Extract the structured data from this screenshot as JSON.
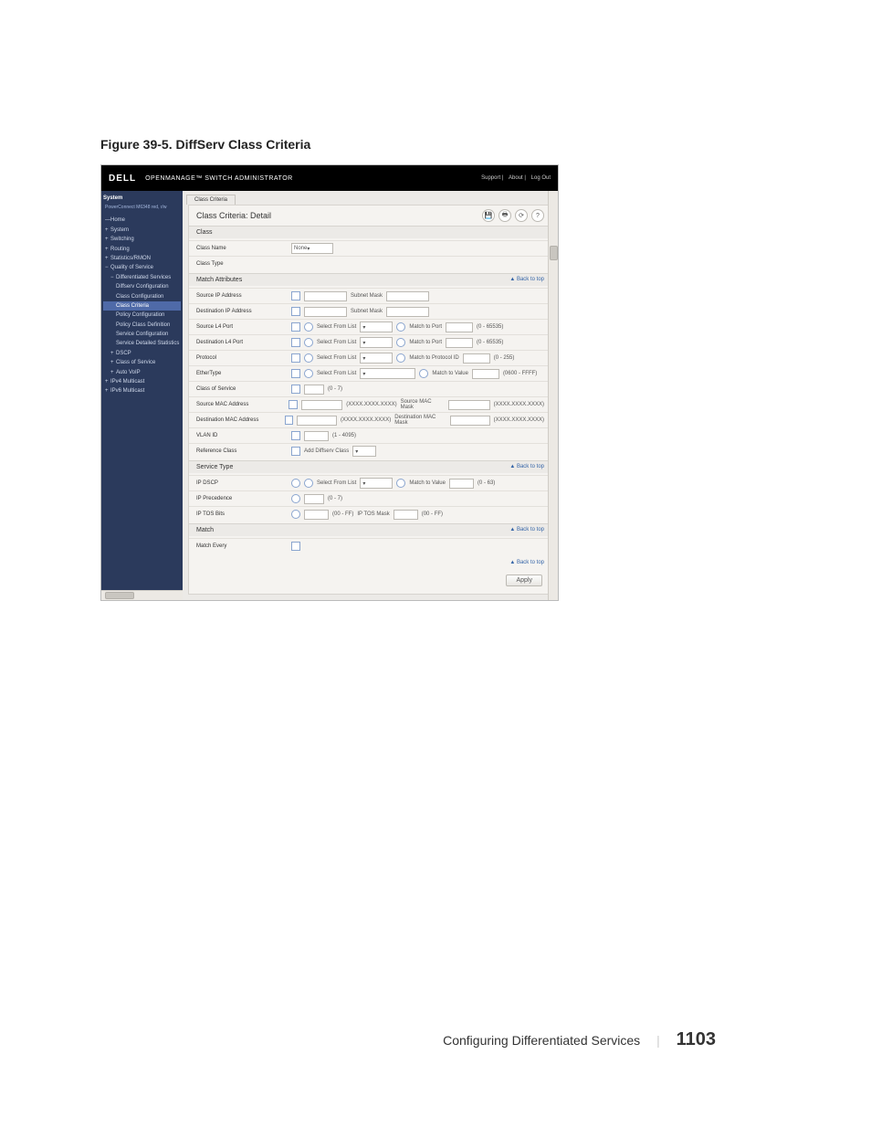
{
  "figure_caption": "Figure 39-5.    DiffServ Class Criteria",
  "topbar": {
    "brand": "DELL",
    "subtitle": "OPENMANAGE™ SWITCH ADMINISTRATOR",
    "links": [
      "Support",
      "About",
      "Log Out"
    ]
  },
  "sidebar": {
    "header": "System",
    "subheader": "PowerConnect M6348\nred, r/w",
    "items": [
      "Home",
      "System",
      "Switching",
      "Routing",
      "Statistics/RMON",
      "Quality of Service"
    ],
    "qos_children": [
      "Differentiated Services",
      "Diffserv Configuration",
      "Class Configuration",
      "Class Criteria",
      "Policy Configuration",
      "Policy Class Definition",
      "Service Configuration",
      "Service Detailed Statistics"
    ],
    "qos_after": [
      "DSCP",
      "Class of Service",
      "Auto VoIP",
      "IPv4 Multicast",
      "IPv6 Multicast"
    ]
  },
  "tab": "Class Criteria",
  "panel_title": "Class Criteria: Detail",
  "sections": {
    "class": {
      "title": "Class",
      "class_name_label": "Class Name",
      "class_name_value": "None",
      "class_type_label": "Class Type"
    },
    "match": {
      "title": "Match Attributes",
      "rows": {
        "src_ip": {
          "label": "Source IP Address",
          "mask_label": "Subnet Mask"
        },
        "dst_ip": {
          "label": "Destination IP Address",
          "mask_label": "Subnet Mask"
        },
        "src_l4": {
          "label": "Source L4 Port",
          "sel": "Select From List",
          "match_label": "Match to Port",
          "range": "(0 - 65535)"
        },
        "dst_l4": {
          "label": "Destination L4 Port",
          "sel": "Select From List",
          "match_label": "Match to Port",
          "range": "(0 - 65535)"
        },
        "protocol": {
          "label": "Protocol",
          "sel": "Select From List",
          "match_label": "Match to Protocol ID",
          "range": "(0 - 255)"
        },
        "ethertype": {
          "label": "EtherType",
          "sel": "Select From List",
          "match_label": "Match to Value",
          "range": "(0600 - FFFF)"
        },
        "cos": {
          "label": "Class of Service",
          "range": "(0 - 7)"
        },
        "src_mac": {
          "label": "Source MAC Address",
          "fmt": "(XXXX.XXXX.XXXX)",
          "mask_label": "Source MAC Mask",
          "mask_fmt": "(XXXX.XXXX.XXXX)"
        },
        "dst_mac": {
          "label": "Destination MAC Address",
          "fmt": "(XXXX.XXXX.XXXX)",
          "mask_label": "Destination MAC Mask",
          "mask_fmt": "(XXXX.XXXX.XXXX)"
        },
        "vlan": {
          "label": "VLAN ID",
          "range": "(1 - 4095)"
        },
        "ref": {
          "label": "Reference Class",
          "btn": "Add Diffserv Class"
        }
      }
    },
    "service": {
      "title": "Service Type",
      "rows": {
        "dscp": {
          "label": "IP DSCP",
          "sel": "Select From List",
          "match_label": "Match to Value",
          "range": "(0 - 63)"
        },
        "prec": {
          "label": "IP Precedence",
          "range": "(0 - 7)"
        },
        "tos": {
          "label": "IP TOS Bits",
          "range1": "(00 - FF)",
          "mask_label": "IP TOS Mask",
          "range2": "(00 - FF)"
        }
      }
    },
    "matchsec": {
      "title": "Match",
      "row": {
        "label": "Match Every"
      }
    }
  },
  "back_to_top": "Back to top",
  "apply": "Apply",
  "page_footer": {
    "text": "Configuring Differentiated Services",
    "page": "1103"
  }
}
